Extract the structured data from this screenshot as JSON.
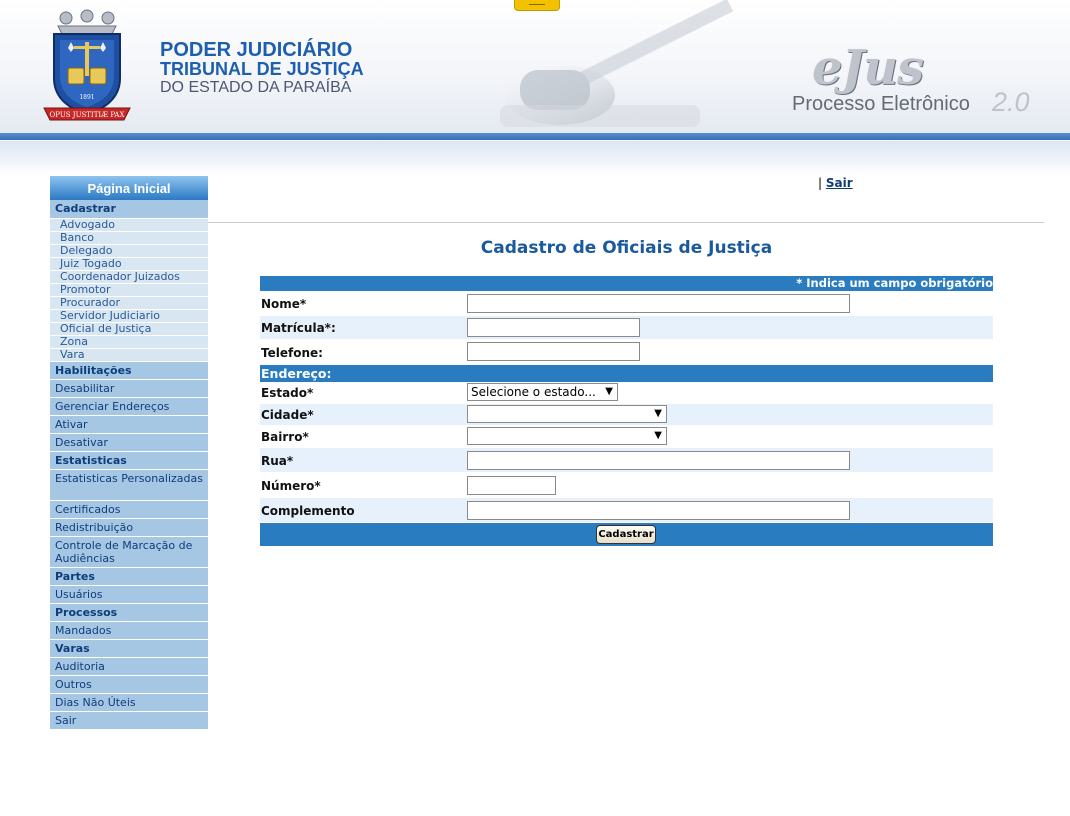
{
  "header": {
    "org_line1": "PODER JUDICIÁRIO",
    "org_line2": "TRIBUNAL DE JUSTIÇA",
    "org_line3": "DO ESTADO DA PARAÍBA",
    "crest_motto": "OPUS JUSTITIÆ PAX",
    "crest_year": "1891",
    "brand": "eJus",
    "brand_subtitle": "Processo Eletrônico",
    "brand_version": "2.0",
    "accent_color": "#2f6bb7"
  },
  "sidebar": {
    "title": "Página Inicial",
    "cadastrar_label": "Cadastrar",
    "cadastrar_items": [
      "Advogado",
      "Banco",
      "Delegado",
      "Juiz Togado",
      "Coordenador Juizados",
      "Promotor",
      "Procurador",
      "Servidor Judiciario",
      "Oficial de Justiça",
      "Zona",
      "Vara"
    ],
    "items": [
      {
        "label": "Habilitações",
        "bold": true
      },
      {
        "label": "Desabilitar",
        "bold": false
      },
      {
        "label": "Gerenciar Endereços",
        "bold": false
      },
      {
        "label": "Ativar",
        "bold": false
      },
      {
        "label": "Desativar",
        "bold": false
      },
      {
        "label": "Estatisticas",
        "bold": true
      },
      {
        "label": "Estatisticas Personalizadas",
        "bold": false
      },
      {
        "label": "Certificados",
        "bold": false
      },
      {
        "label": "Redistribuição",
        "bold": false
      },
      {
        "label": "Controle de Marcação de Audiências",
        "bold": false
      },
      {
        "label": "Partes",
        "bold": true
      },
      {
        "label": "Usuários",
        "bold": false
      },
      {
        "label": "Processos",
        "bold": true
      },
      {
        "label": "Mandados",
        "bold": false
      },
      {
        "label": "Varas",
        "bold": true
      },
      {
        "label": "Auditoria",
        "bold": false
      },
      {
        "label": "Outros",
        "bold": false
      },
      {
        "label": "Dias Não Úteis",
        "bold": false
      },
      {
        "label": "Sair",
        "bold": false
      }
    ]
  },
  "topbar": {
    "separator": "|",
    "logout_link": "Sair"
  },
  "form": {
    "title": "Cadastro de Oficiais de Justiça",
    "required_note": "* Indica um campo obrigatório",
    "nome_label": "Nome*",
    "nome_value": "",
    "matricula_label": "Matrícula*:",
    "matricula_value": "",
    "telefone_label": "Telefone:",
    "telefone_value": "",
    "endereco_label": "Endereço:",
    "estado_label": "Estado*",
    "estado_selected": "Selecione o estado...",
    "cidade_label": "Cidade*",
    "cidade_selected": "",
    "bairro_label": "Bairro*",
    "bairro_selected": "",
    "rua_label": "Rua*",
    "rua_value": "",
    "numero_label": "Número*",
    "numero_value": "",
    "complemento_label": "Complemento",
    "complemento_value": "",
    "submit_label": "Cadastrar"
  }
}
